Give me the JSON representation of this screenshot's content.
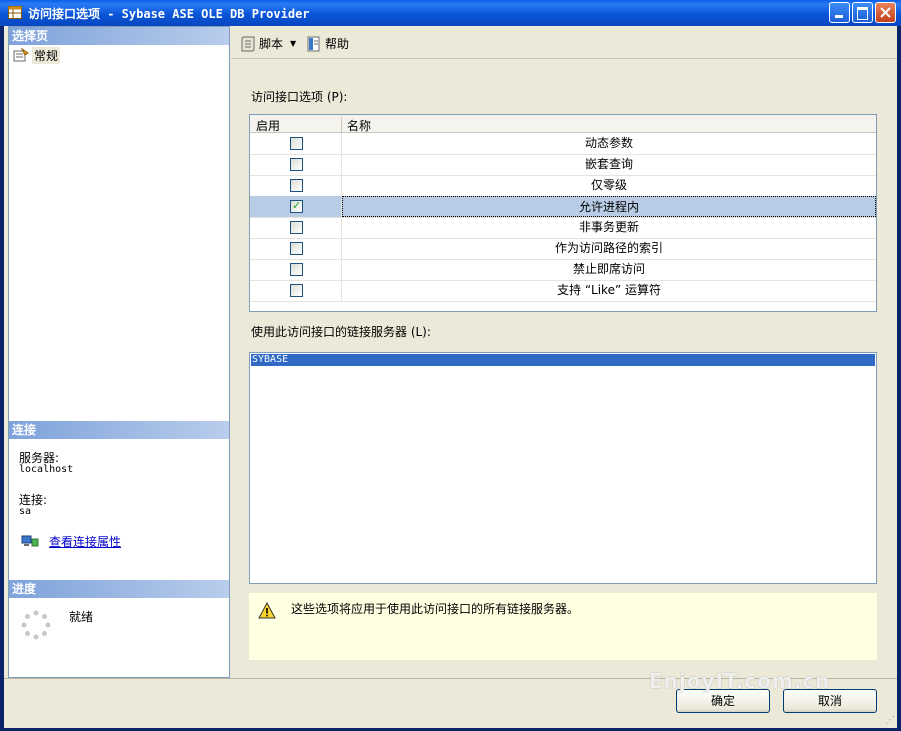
{
  "window": {
    "title": "访问接口选项 - Sybase ASE OLE DB Provider",
    "icon": "table-icon",
    "controls": [
      "minimize-icon",
      "maximize-icon",
      "close-icon"
    ]
  },
  "left_pane": {
    "pages_header": "选择页",
    "pages": [
      {
        "label": "常规",
        "icon": "properties-icon"
      }
    ],
    "connection_header": "连接",
    "server_label": "服务器:",
    "server_value": "localhost",
    "connection_label": "连接:",
    "connection_value": "sa",
    "view_connection_properties": "查看连接属性",
    "progress_header": "进度",
    "progress_status": "就绪"
  },
  "toolbar": {
    "script_label": "脚本",
    "help_label": "帮助"
  },
  "main": {
    "options_label": "访问接口选项 (P):",
    "grid_columns": [
      "启用",
      "名称"
    ],
    "options": [
      {
        "name": "动态参数",
        "enabled": false
      },
      {
        "name": "嵌套查询",
        "enabled": false
      },
      {
        "name": "仅零级",
        "enabled": false
      },
      {
        "name": "允许进程内",
        "enabled": true
      },
      {
        "name": "非事务更新",
        "enabled": false
      },
      {
        "name": "作为访问路径的索引",
        "enabled": false
      },
      {
        "name": "禁止即席访问",
        "enabled": false
      },
      {
        "name": "支持 “Like” 运算符",
        "enabled": false
      }
    ],
    "selected_option_index": 3,
    "linked_servers_label": "使用此访问接口的链接服务器 (L):",
    "linked_servers": [
      "SYBASE"
    ],
    "warning_text": "这些选项将应用于使用此访问接口的所有链接服务器。"
  },
  "buttons": {
    "ok_label": "确定",
    "cancel_label": "取消"
  },
  "watermark": "EnjoyIT.com.cn"
}
